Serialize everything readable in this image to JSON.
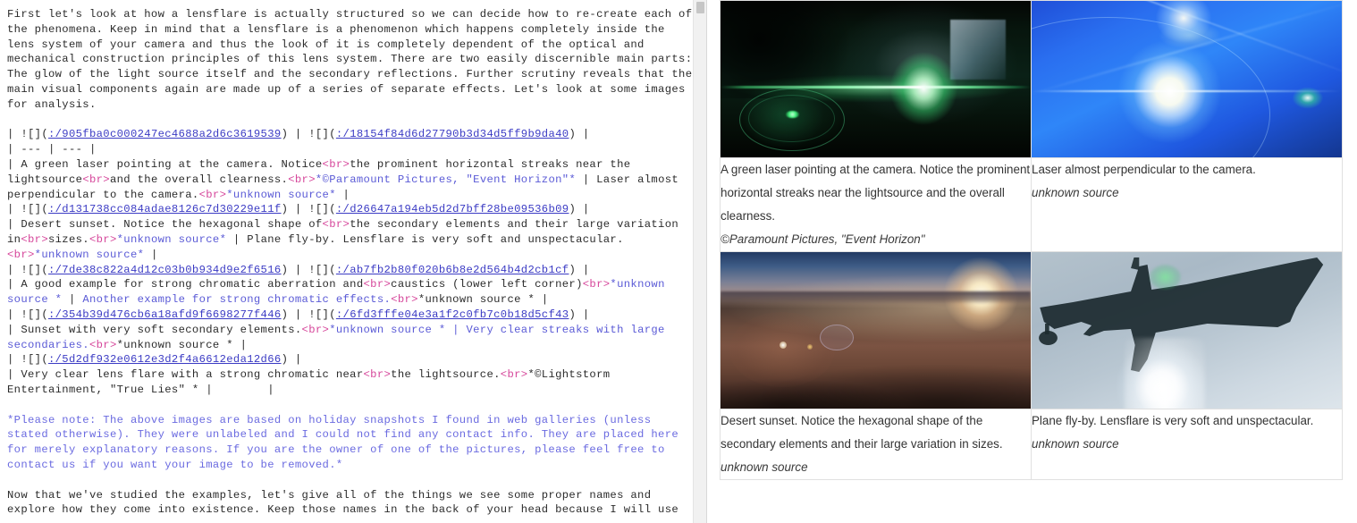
{
  "editor": {
    "lines": [
      {
        "type": "p",
        "spans": [
          {
            "c": "plain",
            "t": "First let's look at how a lensflare is actually structured so we can decide how to re-create each of the phenomena. Keep in mind that a lensflare is a phenomenon which happens completely inside the lens system of your camera and thus the look of it is completely dependent of the optical and mechanical construction principles of this lens system. There are two easily discernible main parts: The glow of the light source itself and the secondary reflections. Further scrutiny reveals that the main visual components again are made up of a series of separate effects. Let's look at some images for analysis."
          }
        ]
      },
      {
        "type": "blank"
      },
      {
        "type": "p",
        "spans": [
          {
            "c": "plain",
            "t": "| ![]("
          },
          {
            "c": "link",
            "t": ":/905fba0c000247ec4688a2d6c3619539"
          },
          {
            "c": "plain",
            "t": ") | ![]("
          },
          {
            "c": "link",
            "t": ":/18154f84d6d27790b3d34d5ff9b9da40"
          },
          {
            "c": "plain",
            "t": ") |"
          }
        ]
      },
      {
        "type": "p",
        "spans": [
          {
            "c": "plain",
            "t": "| --- | --- |"
          }
        ]
      },
      {
        "type": "p",
        "spans": [
          {
            "c": "plain",
            "t": "| A green laser pointing at the camera. Notice"
          },
          {
            "c": "tag",
            "t": "<br>"
          },
          {
            "c": "plain",
            "t": "the prominent horizontal streaks near the lightsource"
          },
          {
            "c": "tag",
            "t": "<br>"
          },
          {
            "c": "plain",
            "t": "and the overall clearness."
          },
          {
            "c": "tag",
            "t": "<br>"
          },
          {
            "c": "em",
            "t": "*©Paramount Pictures, \"Event Horizon\"*"
          },
          {
            "c": "plain",
            "t": " | Laser almost perpendicular to the camera."
          },
          {
            "c": "tag",
            "t": "<br>"
          },
          {
            "c": "em",
            "t": "*unknown source*"
          },
          {
            "c": "plain",
            "t": " |"
          }
        ]
      },
      {
        "type": "p",
        "spans": [
          {
            "c": "plain",
            "t": "| ![]("
          },
          {
            "c": "link",
            "t": ":/d131738cc084adae8126c7d30229e11f"
          },
          {
            "c": "plain",
            "t": ") | ![]("
          },
          {
            "c": "link",
            "t": ":/d26647a194eb5d2d7bff28be09536b09"
          },
          {
            "c": "plain",
            "t": ") |"
          }
        ]
      },
      {
        "type": "p",
        "spans": [
          {
            "c": "plain",
            "t": "| Desert sunset. Notice the hexagonal shape of"
          },
          {
            "c": "tag",
            "t": "<br>"
          },
          {
            "c": "plain",
            "t": "the secondary elements and their large variation in"
          },
          {
            "c": "tag",
            "t": "<br>"
          },
          {
            "c": "plain",
            "t": "sizes."
          },
          {
            "c": "tag",
            "t": "<br>"
          },
          {
            "c": "em",
            "t": "*unknown source*"
          },
          {
            "c": "plain",
            "t": " | Plane fly-by. Lensflare is very soft and unspectacular."
          },
          {
            "c": "tag",
            "t": "<br>"
          },
          {
            "c": "em",
            "t": "*unknown source*"
          },
          {
            "c": "plain",
            "t": " |"
          }
        ]
      },
      {
        "type": "p",
        "spans": [
          {
            "c": "plain",
            "t": "| ![]("
          },
          {
            "c": "link",
            "t": ":/7de38c822a4d12c03b0b934d9e2f6516"
          },
          {
            "c": "plain",
            "t": ") | ![]("
          },
          {
            "c": "link",
            "t": ":/ab7fb2b80f020b6b8e2d564b4d2cb1cf"
          },
          {
            "c": "plain",
            "t": ") |"
          }
        ]
      },
      {
        "type": "p",
        "spans": [
          {
            "c": "plain",
            "t": "| A good example for strong chromatic aberration and"
          },
          {
            "c": "tag",
            "t": "<br>"
          },
          {
            "c": "plain",
            "t": "caustics (lower left corner)"
          },
          {
            "c": "tag",
            "t": "<br>"
          },
          {
            "c": "em",
            "t": "*unknown source *"
          },
          {
            "c": "plain",
            "t": " | "
          },
          {
            "c": "em",
            "t": "Another example for strong chromatic effects."
          },
          {
            "c": "tag",
            "t": "<br>"
          },
          {
            "c": "plain",
            "t": "*unknown source * |"
          }
        ]
      },
      {
        "type": "p",
        "spans": [
          {
            "c": "plain",
            "t": "| ![]("
          },
          {
            "c": "link",
            "t": ":/354b39d476cb6a18afd9f6698277f446"
          },
          {
            "c": "plain",
            "t": ") | ![]("
          },
          {
            "c": "link",
            "t": ":/6fd3fffe04e3a1f2c0fb7c0b18d5cf43"
          },
          {
            "c": "plain",
            "t": ") |"
          }
        ]
      },
      {
        "type": "p",
        "spans": [
          {
            "c": "plain",
            "t": "| Sunset with very soft secondary elements."
          },
          {
            "c": "tag",
            "t": "<br>"
          },
          {
            "c": "em",
            "t": "*unknown source * | Very clear streaks with large secondaries."
          },
          {
            "c": "tag",
            "t": "<br>"
          },
          {
            "c": "plain",
            "t": "*unknown source * |"
          }
        ]
      },
      {
        "type": "p",
        "spans": [
          {
            "c": "plain",
            "t": "| ![]("
          },
          {
            "c": "link",
            "t": ":/5d2df932e0612e3d2f4a6612eda12d66"
          },
          {
            "c": "plain",
            "t": ") |"
          }
        ]
      },
      {
        "type": "p",
        "spans": [
          {
            "c": "plain",
            "t": "| Very clear lens flare with a strong chromatic near"
          },
          {
            "c": "tag",
            "t": "<br>"
          },
          {
            "c": "plain",
            "t": "the lightsource."
          },
          {
            "c": "tag",
            "t": "<br>"
          },
          {
            "c": "plain",
            "t": "*©Lightstorm Entertainment, \"True Lies\" * |        |"
          }
        ]
      },
      {
        "type": "blank"
      },
      {
        "type": "p",
        "spans": [
          {
            "c": "note",
            "t": "*Please note: The above images are based on holiday snapshots I found in web galleries (unless stated otherwise). They were unlabeled and I could not find any contact info. They are placed here for merely explanatory reasons. If you are the owner of one of the pictures, please feel free to contact us if you want your image to be removed.*"
          }
        ]
      },
      {
        "type": "blank"
      },
      {
        "type": "p",
        "spans": [
          {
            "c": "plain",
            "t": "Now that we've studied the examples, let's give all of the things we see some proper names and explore how they come into existence. Keep those names in the back of your head because I will use"
          }
        ]
      }
    ]
  },
  "preview": {
    "rows": [
      {
        "images": [
          {
            "name": "green-laser-photo",
            "alt": "A green laser pointing at the camera"
          },
          {
            "name": "blue-flare-photo",
            "alt": "Laser almost perpendicular to the camera"
          }
        ],
        "captions": [
          {
            "text": "A green laser pointing at the camera. Notice the prominent horizontal streaks near the lightsource and the overall clearness.",
            "source": "©Paramount Pictures, \"Event Horizon\""
          },
          {
            "text": "Laser almost perpendicular to the camera.",
            "source": "unknown source"
          }
        ]
      },
      {
        "images": [
          {
            "name": "desert-sunset-photo",
            "alt": "Desert sunset with hexagonal secondary elements"
          },
          {
            "name": "plane-flyby-photo",
            "alt": "Plane fly-by with soft lensflare"
          }
        ],
        "captions": [
          {
            "text": "Desert sunset. Notice the hexagonal shape of the secondary elements and their large variation in sizes.",
            "source": "unknown source"
          },
          {
            "text": "Plane fly-by. Lensflare is very soft and unspectacular.",
            "source": "unknown source"
          }
        ]
      }
    ]
  },
  "colors": {
    "editor_text": "#2b2b2b",
    "markdown_emphasis": "#5a5ad6",
    "markdown_tag": "#d6479b",
    "markdown_link": "#3b3bc4",
    "preview_border": "#e0e0e0",
    "scrollbar_track": "#f1f1f1",
    "scrollbar_thumb": "#c6c6c6"
  }
}
